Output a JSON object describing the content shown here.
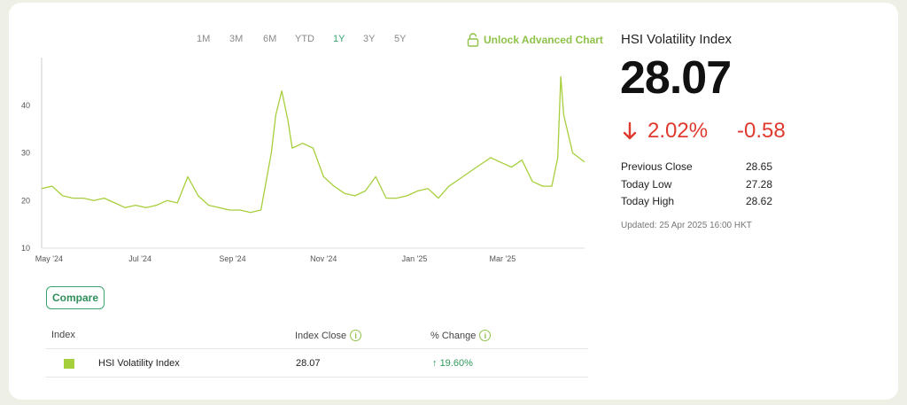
{
  "range_tabs": [
    {
      "label": "1M",
      "active": false
    },
    {
      "label": "3M",
      "active": false
    },
    {
      "label": "6M",
      "active": false
    },
    {
      "label": "YTD",
      "active": false
    },
    {
      "label": "1Y",
      "active": true
    },
    {
      "label": "3Y",
      "active": false
    },
    {
      "label": "5Y",
      "active": false
    }
  ],
  "unlock_label": "Unlock Advanced Chart",
  "chart_data": {
    "type": "line",
    "series": [
      {
        "color": "#a6cf3c",
        "x": [
          "2024-04-26",
          "2024-05-03",
          "2024-05-10",
          "2024-05-17",
          "2024-05-24",
          "2024-05-31",
          "2024-06-07",
          "2024-06-14",
          "2024-06-21",
          "2024-06-28",
          "2024-07-05",
          "2024-07-12",
          "2024-07-19",
          "2024-07-26",
          "2024-08-02",
          "2024-08-09",
          "2024-08-16",
          "2024-08-23",
          "2024-08-30",
          "2024-09-06",
          "2024-09-13",
          "2024-09-20",
          "2024-09-27",
          "2024-09-30",
          "2024-10-04",
          "2024-10-08",
          "2024-10-11",
          "2024-10-18",
          "2024-10-25",
          "2024-11-01",
          "2024-11-08",
          "2024-11-15",
          "2024-11-22",
          "2024-11-29",
          "2024-12-06",
          "2024-12-13",
          "2024-12-20",
          "2024-12-27",
          "2025-01-03",
          "2025-01-10",
          "2025-01-17",
          "2025-01-24",
          "2025-01-31",
          "2025-02-07",
          "2025-02-14",
          "2025-02-21",
          "2025-02-28",
          "2025-03-07",
          "2025-03-14",
          "2025-03-21",
          "2025-03-28",
          "2025-04-03",
          "2025-04-07",
          "2025-04-09",
          "2025-04-11",
          "2025-04-17",
          "2025-04-25"
        ],
        "values": [
          22.5,
          23.0,
          21.0,
          20.5,
          20.5,
          20.0,
          20.5,
          19.5,
          18.5,
          19.0,
          18.5,
          19.0,
          20.0,
          19.5,
          25.0,
          21.0,
          19.0,
          18.5,
          18.0,
          18.0,
          17.5,
          18.0,
          30.0,
          38.0,
          43.0,
          37.0,
          31.0,
          32.0,
          31.0,
          25.0,
          23.0,
          21.5,
          21.0,
          22.0,
          25.0,
          20.5,
          20.5,
          21.0,
          22.0,
          22.5,
          20.5,
          23.0,
          24.5,
          26.0,
          27.5,
          29.0,
          28.0,
          27.0,
          28.5,
          24.0,
          23.0,
          23.0,
          29.0,
          46.0,
          38.0,
          30.0,
          28.07
        ]
      }
    ],
    "x_ticks": [
      "May '24",
      "Jul '24",
      "Sep '24",
      "Nov '24",
      "Jan '25",
      "Mar '25"
    ],
    "y_ticks": [
      10,
      20,
      30,
      40
    ],
    "ylim": [
      10,
      50
    ],
    "grid": false
  },
  "compare_label": "Compare",
  "table": {
    "headers": {
      "index": "Index",
      "close": "Index Close",
      "change": "% Change"
    },
    "rows": [
      {
        "name": "HSI Volatility Index",
        "close": "28.07",
        "change": "19.60%",
        "color": "#a6cf3c"
      }
    ]
  },
  "quote": {
    "title": "HSI Volatility Index",
    "price": "28.07",
    "change_pct": "2.02%",
    "change_abs": "-0.58",
    "stats": [
      {
        "label": "Previous Close",
        "value": "28.65"
      },
      {
        "label": "Today Low",
        "value": "27.28"
      },
      {
        "label": "Today High",
        "value": "28.62"
      }
    ],
    "updated": "Updated: 25 Apr 2025 16:00 HKT"
  }
}
